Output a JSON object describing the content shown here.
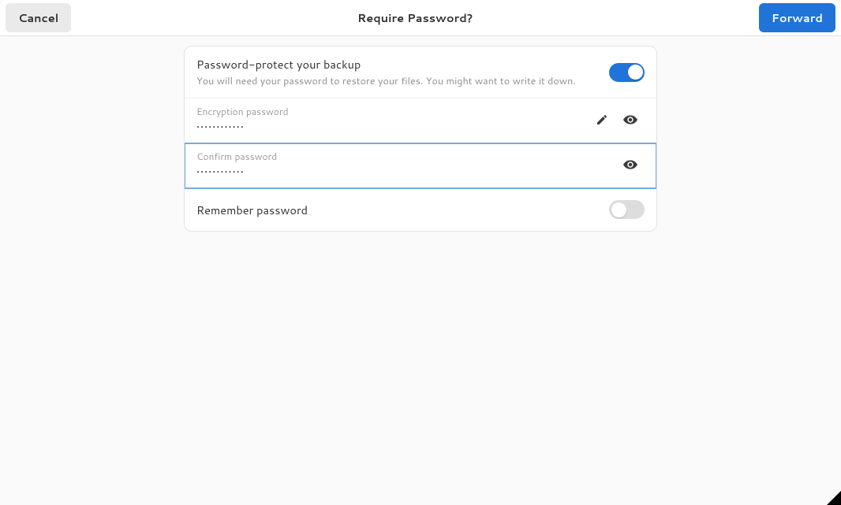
{
  "header": {
    "cancel": "Cancel",
    "title": "Require Password?",
    "forward": "Forward"
  },
  "protect": {
    "title": "Password-protect your backup",
    "subtitle": "You will need your password to restore your files. You might want to write it down.",
    "enabled": true
  },
  "encryption": {
    "label": "Encryption password",
    "value": "••••••••••••"
  },
  "confirm": {
    "label": "Confirm password",
    "value": "••••••••••••"
  },
  "remember": {
    "label": "Remember password",
    "enabled": false
  }
}
